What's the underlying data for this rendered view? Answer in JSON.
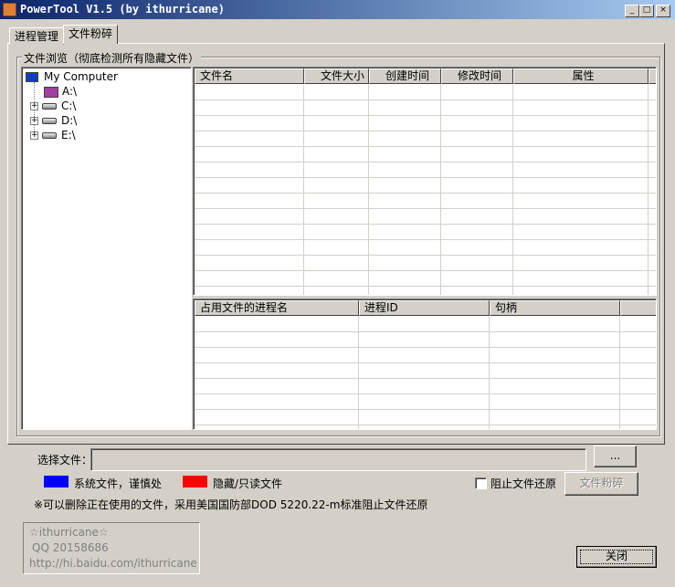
{
  "window": {
    "title": "PowerTool V1.5 (by ithurricane)",
    "minimize": "_",
    "maximize": "□",
    "close": "×"
  },
  "tabs": [
    {
      "label": "进程管理",
      "active": false
    },
    {
      "label": "文件粉碎",
      "active": true
    }
  ],
  "group": {
    "label": "文件浏览（彻底检测所有隐藏文件）"
  },
  "tree": {
    "root": "My Computer",
    "items": [
      "A:\\",
      "C:\\",
      "D:\\",
      "E:\\"
    ]
  },
  "file_list": {
    "columns": [
      "文件名",
      "文件大小",
      "创建时间",
      "修改时间",
      "属性"
    ],
    "rows": []
  },
  "process_list": {
    "columns": [
      "占用文件的进程名",
      "进程ID",
      "句柄"
    ],
    "rows": []
  },
  "select_file": {
    "label": "选择文件：",
    "value": "",
    "browse": "..."
  },
  "legend": [
    {
      "color": "#0000ff",
      "label": "系统文件，谨慎处"
    },
    {
      "color": "#ff0000",
      "label": "隐藏/只读文件"
    }
  ],
  "prevent_restore": {
    "label": "阻止文件还原",
    "checked": false
  },
  "shred_button": "文件粉碎",
  "note": "※可以删除正在使用的文件，采用美国国防部DOD 5220.22-m标准阻止文件还原",
  "about": {
    "line1": "☆ithurricane☆",
    "line2": "QQ 20158686",
    "line3": "http://hi.baidu.com/ithurricane"
  },
  "close_button": "关闭"
}
